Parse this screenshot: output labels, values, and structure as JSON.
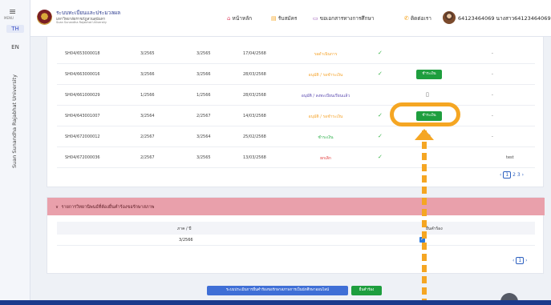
{
  "sidebar": {
    "menu_label": "MENU",
    "lang_th": "TH",
    "lang_en": "EN",
    "university": "Suan Sunandha Rajabhat University"
  },
  "header": {
    "brand_line1": "ระบบทะเบียนและประมวลผล",
    "brand_line2": "มหาวิทยาลัยราชภัฏสวนสุนันทา",
    "brand_line3": "Suan Sunandha Rajabhat University",
    "nav": [
      {
        "icon": "home-icon",
        "glyph": "⌂",
        "label": "หน้าหลัก"
      },
      {
        "icon": "register-icon",
        "glyph": "▤",
        "label": "รับสมัคร"
      },
      {
        "icon": "document-request-icon",
        "glyph": "▭",
        "label": "ขอเอกสารทางการศึกษา"
      },
      {
        "icon": "phone-icon",
        "glyph": "✆",
        "label": "ติดต่อเรา"
      }
    ],
    "user_label": "64123464069 นางสาว64123464069 สมบดี ∨"
  },
  "requests": {
    "rows": [
      {
        "code": "SH04/653000018",
        "term1": "3/2565",
        "term2": "3/2565",
        "date": "17/04/2568",
        "status": "รอดำเนินการ",
        "status_color": "orange",
        "check": "✓",
        "action": "",
        "dash": "-"
      },
      {
        "code": "SH04/663000016",
        "term1": "3/2566",
        "term2": "3/2566",
        "date": "28/03/2568",
        "status": "อนุมัติ / รอชำระเงิน",
        "status_color": "mixed",
        "check": "✓",
        "action": "pay",
        "dash": "-"
      },
      {
        "code": "SH04/661000029",
        "term1": "1/2566",
        "term2": "1/2566",
        "date": "28/03/2568",
        "status": "อนุมัติ / ลงทะเบียนเรียนแล้ว",
        "status_color": "mixed-purple",
        "check": "",
        "action": "doc",
        "dash": "-"
      },
      {
        "code": "SH04/643001007",
        "term1": "3/2564",
        "term2": "2/2567",
        "date": "14/03/2568",
        "status": "อนุมัติ / รอชำระเงิน",
        "status_color": "mixed",
        "check": "✓",
        "action": "pay",
        "dash": "-"
      },
      {
        "code": "SH04/672000012",
        "term1": "2/2567",
        "term2": "3/2564",
        "date": "25/02/2568",
        "status": "ชำระเงิน",
        "status_color": "green",
        "check": "✓",
        "action": "doc",
        "dash": "-"
      },
      {
        "code": "SH04/672000036",
        "term1": "2/2567",
        "term2": "3/2565",
        "date": "13/03/2568",
        "status": "ยกเลิก",
        "status_color": "red",
        "check": "✓",
        "action": "",
        "dash": "",
        "extra": "test"
      }
    ],
    "pay_label": "ชำระเงิน",
    "approved_label": "อนุมัติ",
    "pager": {
      "prev": "‹",
      "pages": [
        "1",
        "2",
        "3"
      ],
      "next": "›"
    }
  },
  "section2": {
    "title": "รายการวิทยานิพนธ์ที่ต้องยื่นคำร้องขอรักษาสภาพ",
    "col_term": "ภาค / ปี",
    "col_submit": "ยื่นคำร้อง",
    "rows": [
      {
        "term": "3/2566",
        "checked": "✓"
      }
    ],
    "pager": {
      "prev": "‹",
      "page": "1",
      "next": "›"
    }
  },
  "footer": {
    "blue_button": "ระบบประเมินการยื่นคำร้องขอรักษาสภาพการเป็นนักศึกษาออนไลน์",
    "green_button": "ยื่นคำร้อง"
  },
  "colors": {
    "accent": "#f5a623",
    "pay_green": "#1e9e3e",
    "pink_header": "#e9a0ab"
  }
}
